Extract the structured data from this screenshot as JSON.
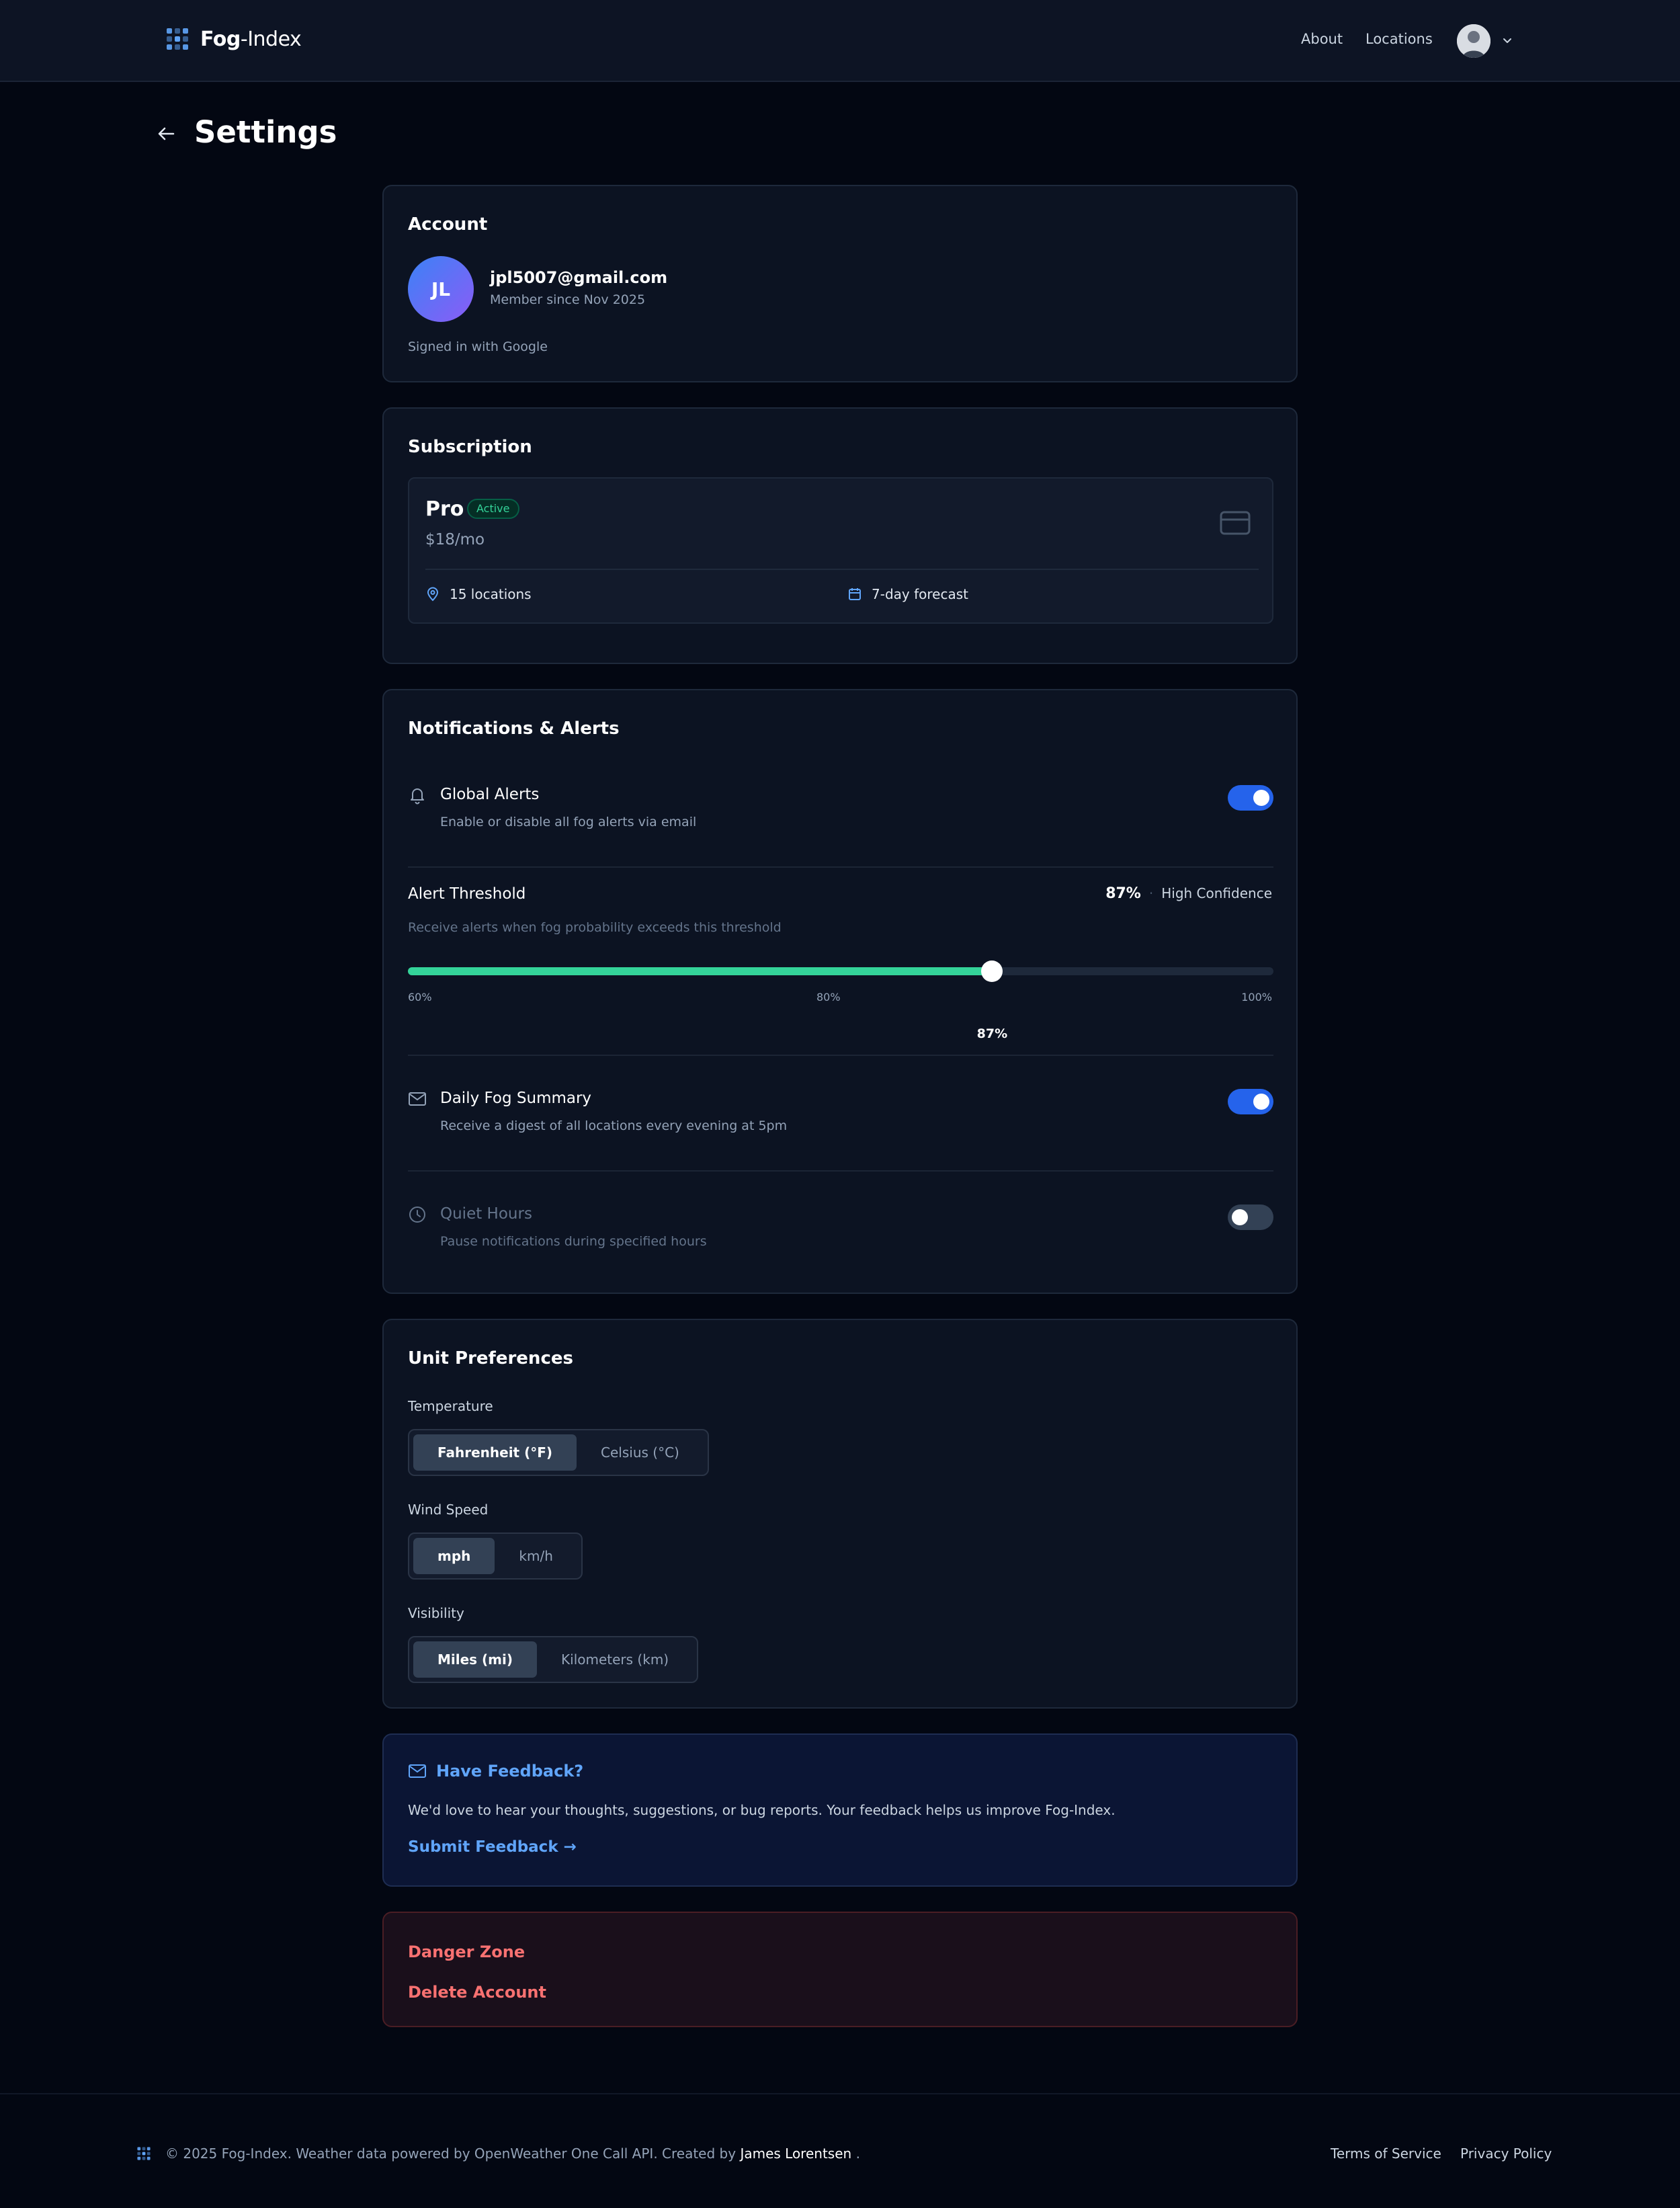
{
  "brand": {
    "name_bold": "Fog",
    "name_rest": "-Index"
  },
  "nav": {
    "about": "About",
    "locations": "Locations"
  },
  "page": {
    "title": "Settings"
  },
  "account": {
    "title": "Account",
    "initials": "JL",
    "email": "jpl5007@gmail.com",
    "member_since": "Member since Nov 2025",
    "signed_in": "Signed in with Google"
  },
  "subscription": {
    "title": "Subscription",
    "plan": "Pro",
    "status": "Active",
    "price": "$18/mo",
    "features": [
      "15 locations",
      "7-day forecast"
    ]
  },
  "notifications": {
    "title": "Notifications & Alerts",
    "global_alerts": {
      "title": "Global Alerts",
      "subtitle": "Enable or disable all fog alerts via email",
      "enabled": true
    },
    "threshold": {
      "title": "Alert Threshold",
      "value_label": "87%",
      "confidence": "High Confidence",
      "subtitle": "Receive alerts when fog probability exceeds this threshold",
      "min": 60,
      "max": 100,
      "value": 87,
      "ticks": [
        "60%",
        "80%",
        "100%"
      ],
      "current": "87%"
    },
    "daily_summary": {
      "title": "Daily Fog Summary",
      "subtitle": "Receive a digest of all locations every evening at 5pm",
      "enabled": true
    },
    "quiet_hours": {
      "title": "Quiet Hours",
      "subtitle": "Pause notifications during specified hours",
      "enabled": false
    }
  },
  "units": {
    "title": "Unit Preferences",
    "temperature": {
      "label": "Temperature",
      "options": [
        "Fahrenheit (°F)",
        "Celsius (°C)"
      ],
      "selected": "Fahrenheit (°F)"
    },
    "wind": {
      "label": "Wind Speed",
      "options": [
        "mph",
        "km/h"
      ],
      "selected": "mph"
    },
    "visibility": {
      "label": "Visibility",
      "options": [
        "Miles (mi)",
        "Kilometers (km)"
      ],
      "selected": "Miles (mi)"
    }
  },
  "feedback": {
    "title": "Have Feedback?",
    "text": "We'd love to hear your thoughts, suggestions, or bug reports. Your feedback helps us improve Fog-Index.",
    "link": "Submit Feedback →"
  },
  "danger": {
    "title": "Danger Zone",
    "delete": "Delete Account"
  },
  "footer": {
    "text": "© 2025 Fog-Index. Weather data powered by OpenWeather One Call API. Created by",
    "author": "James Lorentsen",
    "period": ".",
    "terms": "Terms of Service",
    "privacy": "Privacy Policy"
  },
  "colors": {
    "accent": "#2563eb",
    "success": "#34d399",
    "link": "#60a5fa",
    "danger": "#f87171",
    "background": "#030712",
    "card": "#0c1322"
  }
}
